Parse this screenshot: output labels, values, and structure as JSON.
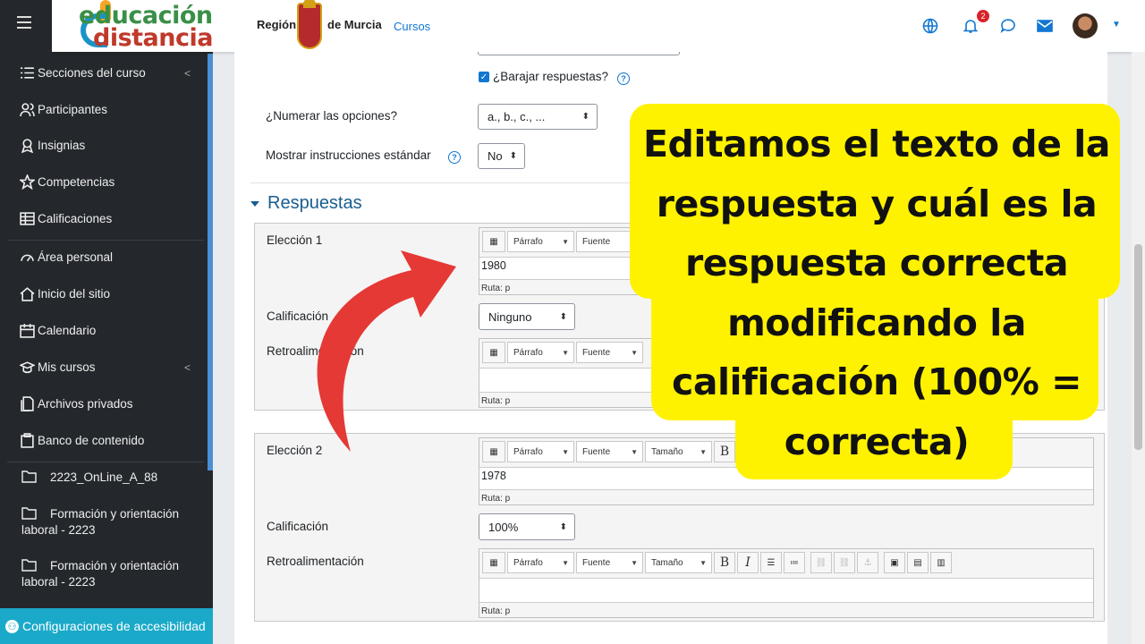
{
  "header": {
    "logo_line1": "educación",
    "logo_line2": "distancia",
    "logo_prefix": "a",
    "region": "Región",
    "murcia": "de Murcia",
    "cursos_link": "Cursos",
    "notification_count": "2"
  },
  "sidebar": {
    "items": [
      {
        "label": "Secciones del curso",
        "icon": "list-icon"
      },
      {
        "label": "Participantes",
        "icon": "users-icon"
      },
      {
        "label": "Insignias",
        "icon": "badge-icon"
      },
      {
        "label": "Competencias",
        "icon": "star-icon"
      },
      {
        "label": "Calificaciones",
        "icon": "table-icon"
      },
      {
        "label": "Área personal",
        "icon": "gauge-icon"
      },
      {
        "label": "Inicio del sitio",
        "icon": "home-icon"
      },
      {
        "label": "Calendario",
        "icon": "calendar-icon"
      },
      {
        "label": "Mis cursos",
        "icon": "graduation-icon"
      },
      {
        "label": "Archivos privados",
        "icon": "files-icon"
      },
      {
        "label": "Banco de contenido",
        "icon": "clipboard-icon"
      }
    ],
    "folders": [
      {
        "label": "2223_OnLine_A_88"
      },
      {
        "label": "Formación y orientación",
        "label2": "laboral - 2223"
      },
      {
        "label": "Formación y orientación",
        "label2": "laboral - 2223"
      }
    ],
    "accessibility": "Configuraciones de accesibilidad"
  },
  "form": {
    "shuffle_label": "¿Barajar respuestas?",
    "numbering_label": "¿Numerar las opciones?",
    "numbering_value": "a., b., c., ...",
    "instructions_label": "Mostrar instrucciones estándar",
    "instructions_value": "No",
    "section_title": "Respuestas",
    "answers": [
      {
        "choice_label": "Elección 1",
        "text": "1980",
        "path": "Ruta: p",
        "grade_label": "Calificación",
        "grade_value": "Ninguno",
        "feedback_label": "Retroalimentación",
        "feedback_path": "Ruta: p"
      },
      {
        "choice_label": "Elección 2",
        "text": "1978",
        "path": "Ruta: p",
        "grade_label": "Calificación",
        "grade_value": "100%",
        "feedback_label": "Retroalimentación",
        "feedback_path": "Ruta: p"
      }
    ]
  },
  "editor": {
    "paragraph": "Párrafo",
    "font": "Fuente",
    "size": "Tamaño",
    "bold": "B",
    "italic": "I"
  },
  "callout": {
    "text": "Editamos el texto de la respuesta y cuál es la respuesta correcta modificando la calificación (100% = correcta)"
  },
  "colors": {
    "accent": "#1177d1",
    "sidebar": "#24282c",
    "callout": "#fff200",
    "arrow": "#e53935"
  }
}
